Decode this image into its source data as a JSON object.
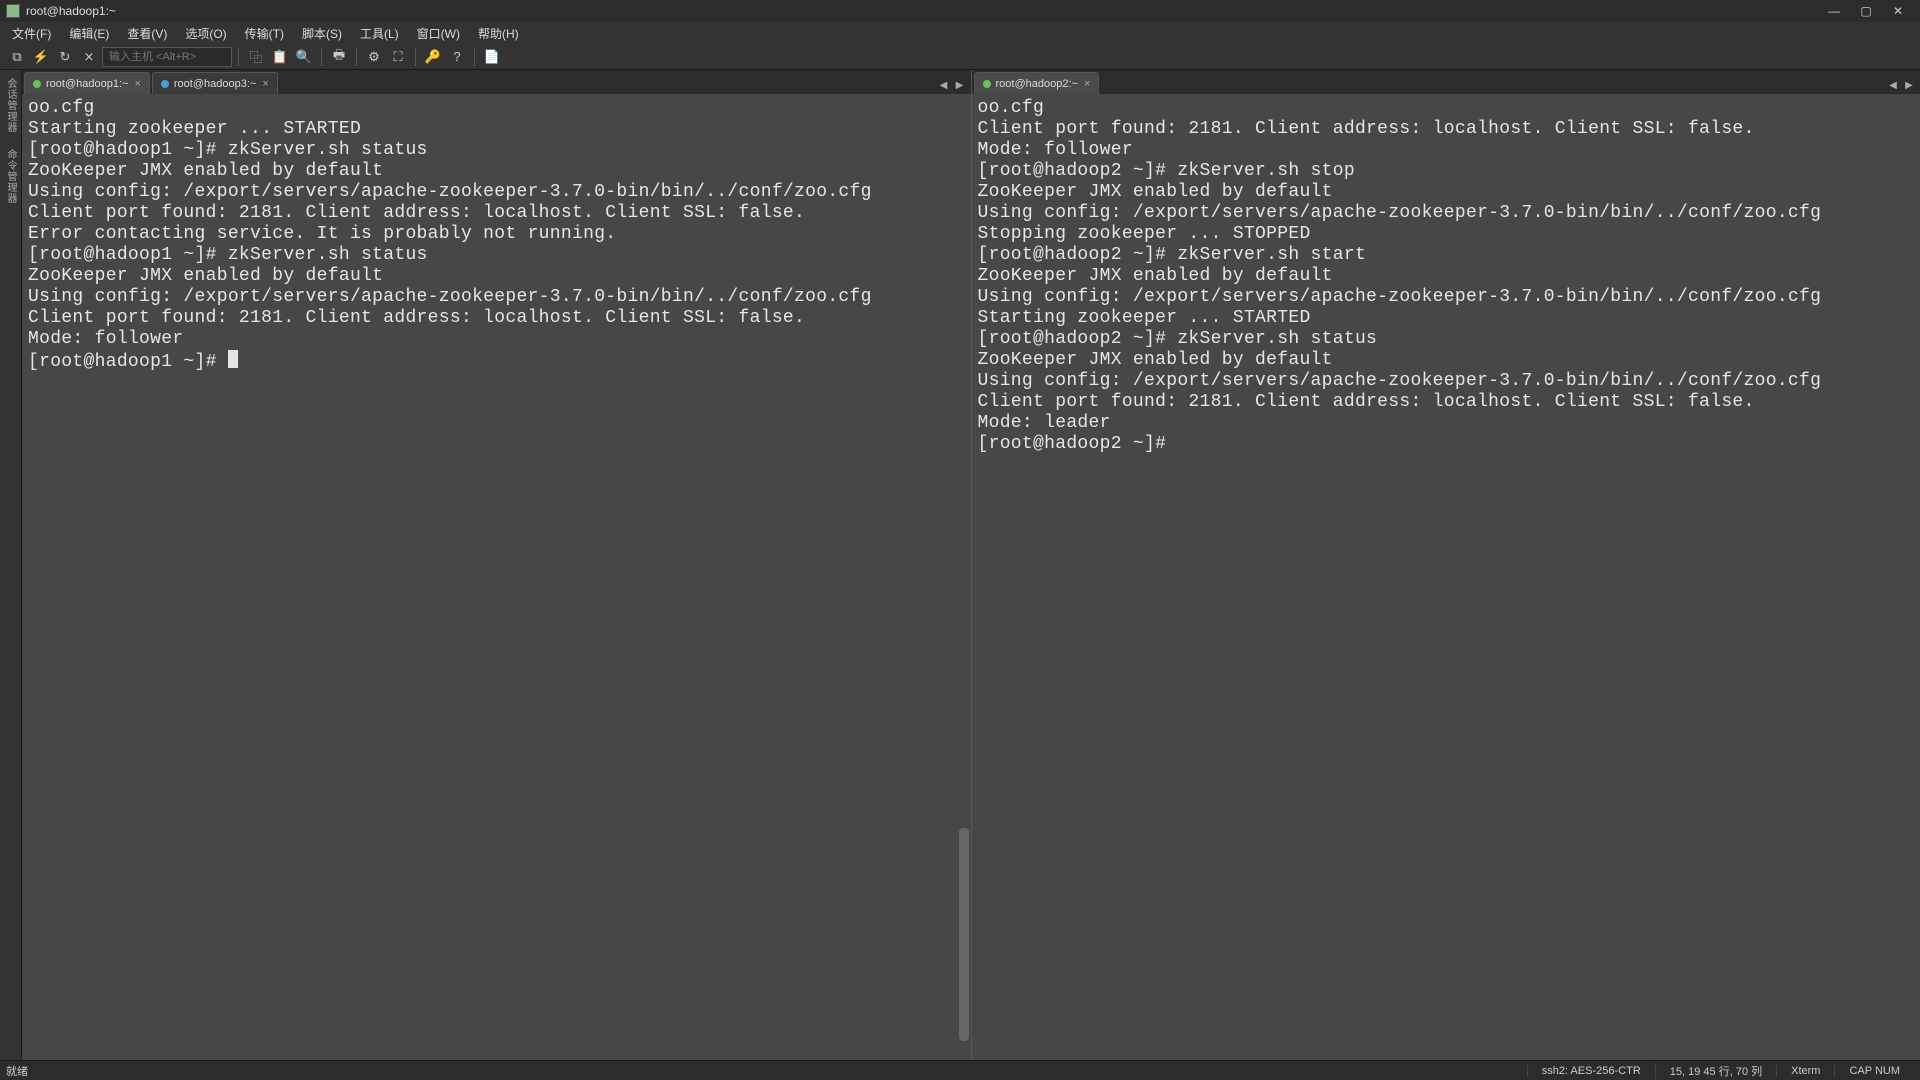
{
  "window": {
    "title": "root@hadoop1:~"
  },
  "menu": {
    "file": "文件(F)",
    "edit": "编辑(E)",
    "view": "查看(V)",
    "options": "选项(O)",
    "transfer": "传输(T)",
    "script": "脚本(S)",
    "tools": "工具(L)",
    "window": "窗口(W)",
    "help": "帮助(H)"
  },
  "toolbar": {
    "host_placeholder": "输入主机 <Alt+R>"
  },
  "side_tabs": {
    "sessions": "会话管理器",
    "commands": "命令管理器"
  },
  "panes": {
    "left": {
      "tabs": [
        {
          "label": "root@hadoop1:~",
          "status": "green",
          "active": true
        },
        {
          "label": "root@hadoop3:~",
          "status": "blue",
          "active": false
        }
      ],
      "content": "oo.cfg\nStarting zookeeper ... STARTED\n[root@hadoop1 ~]# zkServer.sh status\nZooKeeper JMX enabled by default\nUsing config: /export/servers/apache-zookeeper-3.7.0-bin/bin/../conf/zoo.cfg\nClient port found: 2181. Client address: localhost. Client SSL: false.\nError contacting service. It is probably not running.\n[root@hadoop1 ~]# zkServer.sh status\nZooKeeper JMX enabled by default\nUsing config: /export/servers/apache-zookeeper-3.7.0-bin/bin/../conf/zoo.cfg\nClient port found: 2181. Client address: localhost. Client SSL: false.\nMode: follower\n[root@hadoop1 ~]# "
    },
    "right": {
      "tabs": [
        {
          "label": "root@hadoop2:~",
          "status": "green",
          "active": true
        }
      ],
      "content": "oo.cfg\nClient port found: 2181. Client address: localhost. Client SSL: false.\nMode: follower\n[root@hadoop2 ~]# zkServer.sh stop\nZooKeeper JMX enabled by default\nUsing config: /export/servers/apache-zookeeper-3.7.0-bin/bin/../conf/zoo.cfg\nStopping zookeeper ... STOPPED\n[root@hadoop2 ~]# zkServer.sh start\nZooKeeper JMX enabled by default\nUsing config: /export/servers/apache-zookeeper-3.7.0-bin/bin/../conf/zoo.cfg\nStarting zookeeper ... STARTED\n[root@hadoop2 ~]# zkServer.sh status\nZooKeeper JMX enabled by default\nUsing config: /export/servers/apache-zookeeper-3.7.0-bin/bin/../conf/zoo.cfg\nClient port found: 2181. Client address: localhost. Client SSL: false.\nMode: leader\n[root@hadoop2 ~]# "
    }
  },
  "statusbar": {
    "ready": "就绪",
    "conn": "ssh2: AES-256-CTR",
    "pos": "15, 19  45 行, 70 列",
    "term": "Xterm",
    "caps": "CAP  NUM"
  }
}
